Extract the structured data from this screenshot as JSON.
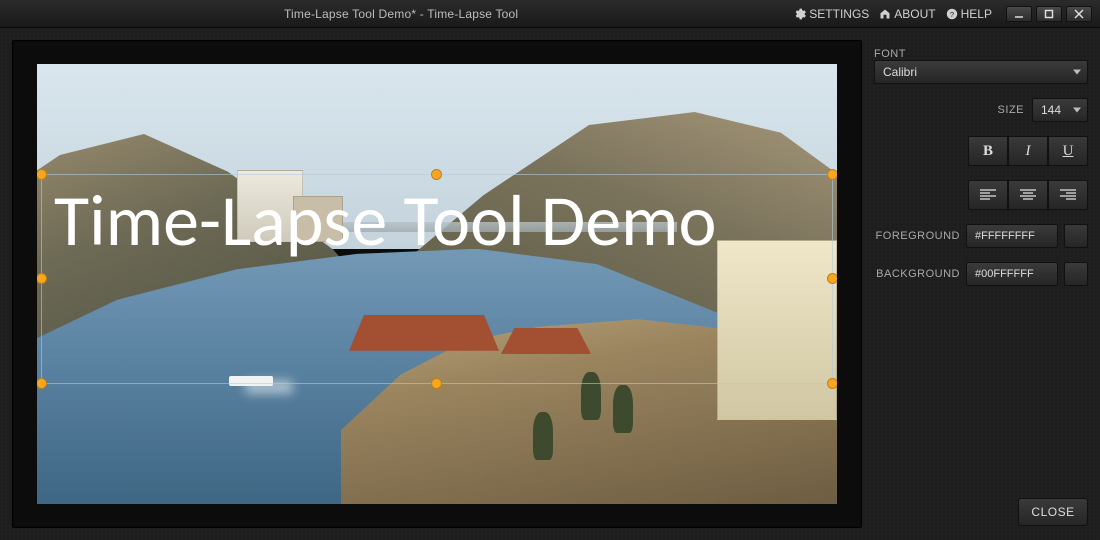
{
  "titlebar": {
    "title": "Time-Lapse Tool Demo* - Time-Lapse Tool",
    "links": {
      "settings": "SETTINGS",
      "about": "ABOUT",
      "help": "HELP"
    }
  },
  "overlay": {
    "text": "Time-Lapse Tool Demo"
  },
  "panel": {
    "font_label": "FONT",
    "font_value": "Calibri",
    "size_label": "SIZE",
    "size_value": "144",
    "bold": "B",
    "italic": "I",
    "underline": "U",
    "foreground_label": "FOREGROUND",
    "foreground_value": "#FFFFFFFF",
    "background_label": "BACKGROUND",
    "background_value": "#00FFFFFF",
    "close": "CLOSE"
  }
}
